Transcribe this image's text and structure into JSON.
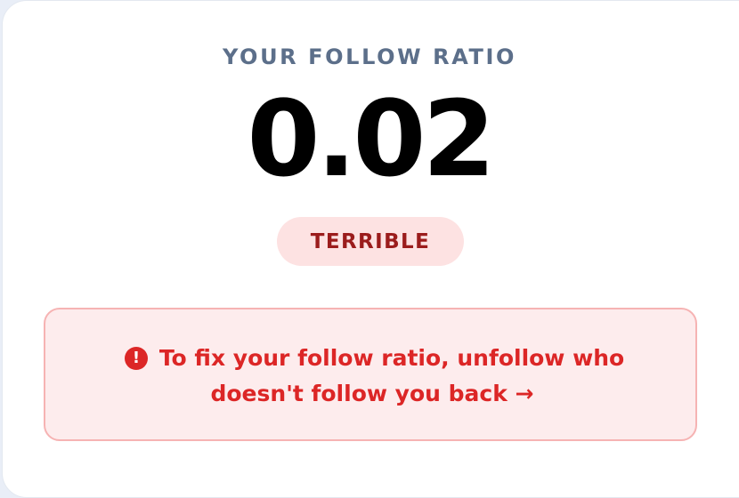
{
  "ratio_card": {
    "eyebrow": "YOUR FOLLOW RATIO",
    "ratio_value": "0.02",
    "rating_badge": "TERRIBLE"
  },
  "alert": {
    "icon": "exclamation-circle-icon",
    "line1": "To fix your follow ratio, unfollow who",
    "line2": "doesn't follow you back →"
  },
  "colors": {
    "eyebrow": "#5c6f8a",
    "badge_bg": "#fde2e2",
    "badge_text": "#9b1c1c",
    "alert_bg": "#fdeced",
    "alert_border": "#f6b3b3",
    "alert_text": "#dc2626"
  }
}
